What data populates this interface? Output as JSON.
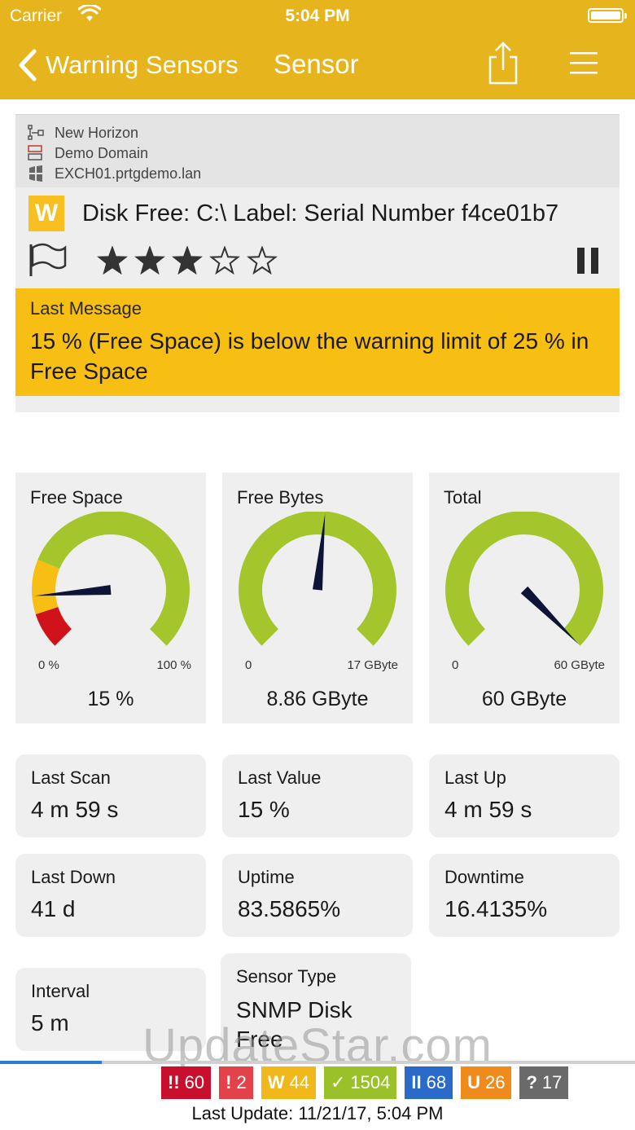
{
  "status_bar": {
    "carrier": "Carrier",
    "time": "5:04 PM"
  },
  "nav": {
    "back_label": "Warning Sensors",
    "title": "Sensor"
  },
  "breadcrumbs": [
    {
      "label": "New Horizon",
      "icon": "probe-icon"
    },
    {
      "label": "Demo Domain",
      "icon": "group-icon"
    },
    {
      "label": "EXCH01.prtgdemo.lan",
      "icon": "device-icon"
    }
  ],
  "sensor": {
    "status_letter": "W",
    "status_color": "#f7c020",
    "title": "Disk Free: C:\\ Label:  Serial Number f4ce01b7",
    "priority_stars": 3,
    "priority_max": 5
  },
  "last_message": {
    "label": "Last Message",
    "text": "15 % (Free Space) is below the warning limit of 25 % in Free Space"
  },
  "gauges": [
    {
      "title": "Free Space",
      "min": "0 %",
      "max": "100 %",
      "value": "15 %",
      "fraction": 0.15,
      "zones": [
        {
          "from": 0,
          "to": 0.1,
          "color": "#d0121b"
        },
        {
          "from": 0.1,
          "to": 0.25,
          "color": "#f7bf14"
        },
        {
          "from": 0.25,
          "to": 1,
          "color": "#a4c52c"
        }
      ]
    },
    {
      "title": "Free Bytes",
      "min": "0",
      "max": "17 GByte",
      "value": "8.86 GByte",
      "fraction": 0.521,
      "zones": [
        {
          "from": 0,
          "to": 1,
          "color": "#a4c52c"
        }
      ]
    },
    {
      "title": "Total",
      "min": "0",
      "max": "60 GByte",
      "value": "60 GByte",
      "fraction": 1.0,
      "zones": [
        {
          "from": 0,
          "to": 1,
          "color": "#a4c52c"
        }
      ]
    }
  ],
  "tiles": {
    "last_scan": {
      "label": "Last Scan",
      "value": "4 m 59 s"
    },
    "last_value": {
      "label": "Last Value",
      "value": "15 %"
    },
    "last_up": {
      "label": "Last Up",
      "value": "4 m 59 s"
    },
    "last_down": {
      "label": "Last Down",
      "value": "41 d"
    },
    "uptime": {
      "label": "Uptime",
      "value": "83.5865%"
    },
    "downtime": {
      "label": "Downtime",
      "value": "16.4135%"
    },
    "interval": {
      "label": "Interval",
      "value": "5 m"
    },
    "sensor_type": {
      "label": "Sensor Type",
      "value": "SNMP Disk Free"
    }
  },
  "watermark": "UpdateStar.com",
  "refresh_progress": 0.16,
  "badges": [
    {
      "symbol": "!!",
      "count": "60",
      "color": "#c8102e"
    },
    {
      "symbol": "!",
      "count": "2",
      "color": "#e2434b"
    },
    {
      "symbol": "W",
      "count": "44",
      "color": "#f1b81b"
    },
    {
      "symbol": "✓",
      "count": "1504",
      "color": "#9bc12a"
    },
    {
      "symbol": "II",
      "count": "68",
      "color": "#2a6bc9"
    },
    {
      "symbol": "U",
      "count": "26",
      "color": "#ef8a1d"
    },
    {
      "symbol": "?",
      "count": "17",
      "color": "#6a6a6a"
    }
  ],
  "last_update": "Last Update: 11/21/17, 5:04 PM",
  "colors": {
    "bar": "#e6b41c",
    "needle": "#0e1438"
  }
}
